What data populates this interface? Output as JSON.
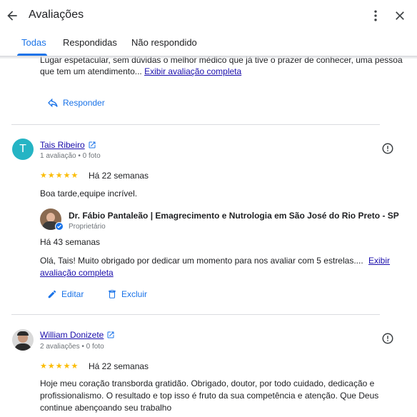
{
  "header": {
    "title": "Avaliações"
  },
  "tabs": [
    {
      "label": "Todas"
    },
    {
      "label": "Respondidas"
    },
    {
      "label": "Não respondido"
    }
  ],
  "reviews": [
    {
      "text": "Lugar espetacular, sem dúvidas o melhor médico que já tive o prazer de conhecer, uma pessoa",
      "text2": "que tem um atendimento...",
      "more_link": "Exibir avaliação completa",
      "reply_label": "Responder"
    },
    {
      "avatar_letter": "T",
      "avatar_color": "#25b4c4",
      "name": "Tais Ribeiro",
      "meta": "1 avaliação • 0 foto",
      "stars": "★★★★★",
      "rating": 5,
      "time": "Há 22 semanas",
      "text": "Boa tarde,equipe incrível.",
      "owner": {
        "name": "Dr. Fábio Pantaleão | Emagrecimento e Nutrologia em São José do Rio Preto - SP",
        "role": "Proprietário",
        "time": "Há 43 semanas",
        "reply_text": "Olá, Tais! Muito obrigado por dedicar um momento para nos avaliar com 5 estrelas....",
        "more_link_1": "Exibir",
        "more_link_2": "avaliação completa"
      },
      "edit_label": "Editar",
      "delete_label": "Excluir"
    },
    {
      "name": "William Donizete",
      "meta": "2 avaliações • 0 foto",
      "stars": "★★★★★",
      "rating": 5,
      "time": "Há 22 semanas",
      "text_lines": [
        "Hoje meu coração transborda gratidão. Obrigado, doutor, por todo cuidado, dedicação e",
        "profissionalismo. O resultado e top isso é fruto da sua competência e atenção. Que Deus",
        "continue abençoando seu trabalho"
      ]
    }
  ],
  "colors": {
    "accent": "#1a73e8",
    "star": "#fbbc04",
    "link": "#1a0dab"
  }
}
